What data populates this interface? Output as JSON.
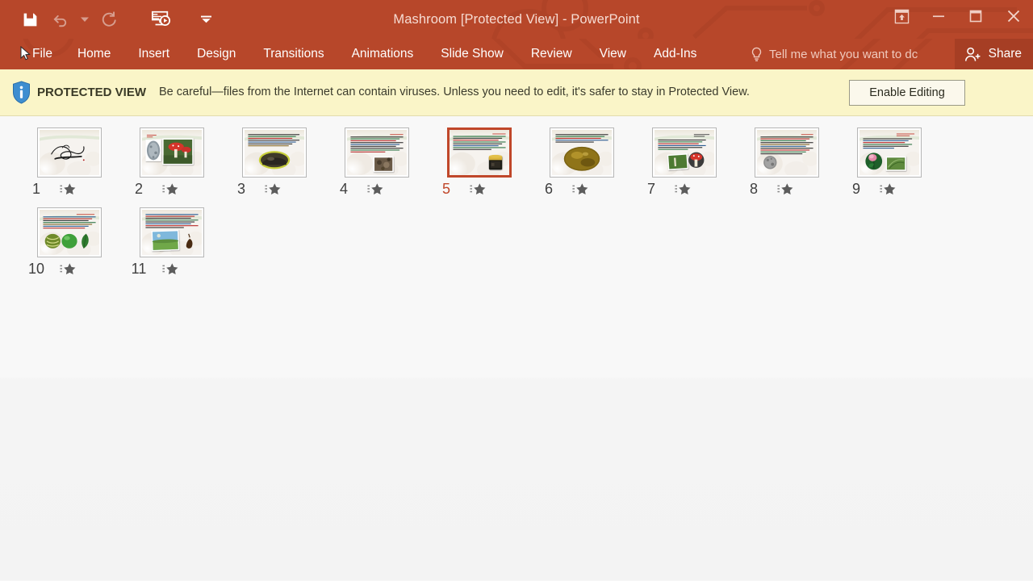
{
  "window": {
    "title": "Mashroom [Protected View] - PowerPoint",
    "accent_color": "#b7472a",
    "share_bg": "#a63e24"
  },
  "quick_access": {
    "items": [
      {
        "name": "save-button",
        "icon": "save-icon",
        "label": "Save",
        "enabled": true
      },
      {
        "name": "undo-button",
        "icon": "undo-icon",
        "label": "Undo",
        "enabled": false
      },
      {
        "name": "undo-dropdown",
        "icon": "chevron-down-icon",
        "label": "Undo options",
        "enabled": false
      },
      {
        "name": "redo-button",
        "icon": "redo-icon",
        "label": "Redo",
        "enabled": false
      },
      {
        "name": "start-presentation-button",
        "icon": "start-from-beginning-icon",
        "label": "Start From Beginning",
        "enabled": true
      },
      {
        "name": "customize-qat-button",
        "icon": "chevron-down-icon",
        "label": "Customize Quick Access Toolbar",
        "enabled": true
      }
    ]
  },
  "window_controls": [
    {
      "name": "ribbon-display-options-button",
      "icon": "ribbon-display-icon",
      "label": "Ribbon Display Options"
    },
    {
      "name": "minimize-button",
      "icon": "minimize-icon",
      "label": "Minimize"
    },
    {
      "name": "maximize-button",
      "icon": "maximize-icon",
      "label": "Restore Down"
    },
    {
      "name": "close-button",
      "icon": "close-icon",
      "label": "Close"
    }
  ],
  "ribbon": {
    "tabs": [
      {
        "label": "File",
        "name": "tab-file"
      },
      {
        "label": "Home",
        "name": "tab-home"
      },
      {
        "label": "Insert",
        "name": "tab-insert"
      },
      {
        "label": "Design",
        "name": "tab-design"
      },
      {
        "label": "Transitions",
        "name": "tab-transitions"
      },
      {
        "label": "Animations",
        "name": "tab-animations"
      },
      {
        "label": "Slide Show",
        "name": "tab-slide-show"
      },
      {
        "label": "Review",
        "name": "tab-review"
      },
      {
        "label": "View",
        "name": "tab-view"
      },
      {
        "label": "Add-Ins",
        "name": "tab-add-ins"
      }
    ],
    "tell_me": {
      "text": "Tell me what you want to dc",
      "icon": "lightbulb-icon"
    },
    "share": {
      "label": "Share",
      "icon": "share-person-icon"
    }
  },
  "protected_view": {
    "icon": "info-shield-icon",
    "label": "PROTECTED VIEW",
    "message": "Be careful—files from the Internet can contain viruses. Unless you need to edit, it's safer to stay in Protected View.",
    "button_label": "Enable Editing",
    "bar_color": "#faf5c8"
  },
  "slide_sorter": {
    "selected_slide": 5,
    "animation_icon": "animation-star-icon",
    "slides": [
      {
        "number": "1",
        "style": "calligraphy"
      },
      {
        "number": "2",
        "style": "two-photos-mushroom"
      },
      {
        "number": "3",
        "style": "text-ellipse-dark"
      },
      {
        "number": "4",
        "style": "text-photo-rock"
      },
      {
        "number": "5",
        "style": "text-jar"
      },
      {
        "number": "6",
        "style": "big-ellipse-gold"
      },
      {
        "number": "7",
        "style": "photo-green-circle-red"
      },
      {
        "number": "8",
        "style": "text-grey-circle"
      },
      {
        "number": "9",
        "style": "flower-circle-leaf"
      },
      {
        "number": "10",
        "style": "three-ellipses-green"
      },
      {
        "number": "11",
        "style": "landscape-photo"
      }
    ]
  }
}
